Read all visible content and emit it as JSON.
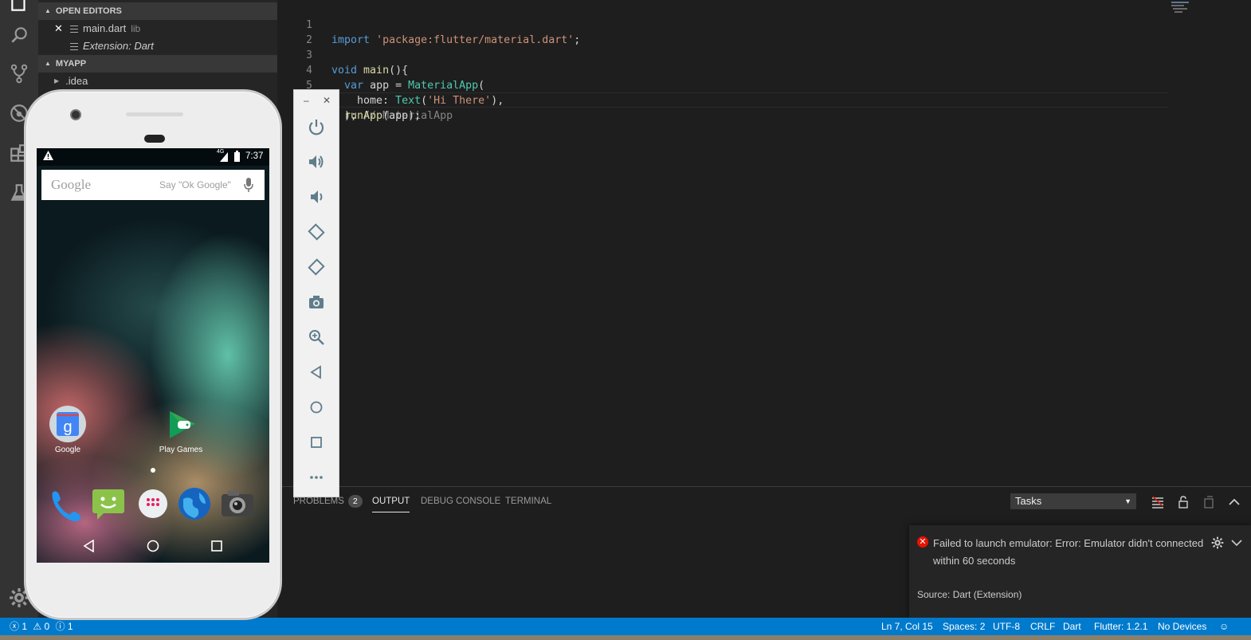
{
  "sidebar": {
    "open_editors_header": "OPEN EDITORS",
    "open_editors": [
      {
        "name": "main.dart",
        "desc": "lib"
      },
      {
        "name": "Extension: Dart",
        "desc": ""
      }
    ],
    "project_header": "MYAPP",
    "project_items": [
      {
        "name": ".idea"
      }
    ]
  },
  "editor": {
    "lines": [
      {
        "num": "1"
      },
      {
        "num": "2"
      },
      {
        "num": "3"
      },
      {
        "num": "4"
      },
      {
        "num": "5"
      },
      {
        "num": "6"
      }
    ],
    "code": {
      "l1_kw": "import",
      "l1_str": "'package:flutter/material.dart'",
      "l1_end": ";",
      "l3_kw": "void",
      "l3_fn": "main",
      "l3_end": "(){",
      "l4_kw": "var",
      "l4_mid": "app =",
      "l4_cls": "MaterialApp",
      "l4_end": "(",
      "l5_prop": "home:",
      "l5_cls": "Text",
      "l5_open": "(",
      "l5_str": "'Hi There'",
      "l5_end": "),",
      "l6_start": ");",
      "l6_cmt": "// MaterialApp",
      "l7_fn": "runApp",
      "l7_end": "(app);"
    }
  },
  "panel": {
    "tabs": [
      {
        "label": "PROBLEMS",
        "badge": "2"
      },
      {
        "label": "OUTPUT"
      },
      {
        "label": "DEBUG CONSOLE"
      },
      {
        "label": "TERMINAL"
      }
    ],
    "tasks_select": "Tasks"
  },
  "notification": {
    "message": "Failed to launch emulator: Error: Emulator didn't connected within 60 seconds",
    "source": "Source: Dart (Extension)"
  },
  "statusbar": {
    "errors": "1",
    "warnings": "0",
    "infos": "1",
    "position": "Ln 7, Col 15",
    "spaces": "Spaces: 2",
    "encoding": "UTF-8",
    "eol": "CRLF",
    "language": "Dart",
    "flutter": "Flutter: 1.2.1",
    "devices": "No Devices"
  },
  "phone": {
    "network": "4G",
    "time": "7:37",
    "search_logo": "Google",
    "search_hint": "Say \"Ok Google\"",
    "apps": [
      {
        "label": "Google"
      },
      {
        "label": "Play Games"
      }
    ]
  },
  "colors": {
    "statusbar_bg": "#007acc",
    "activity_bar": "#333333",
    "sidebar": "#252526",
    "editor": "#1e1e1e",
    "error": "#e51400"
  }
}
